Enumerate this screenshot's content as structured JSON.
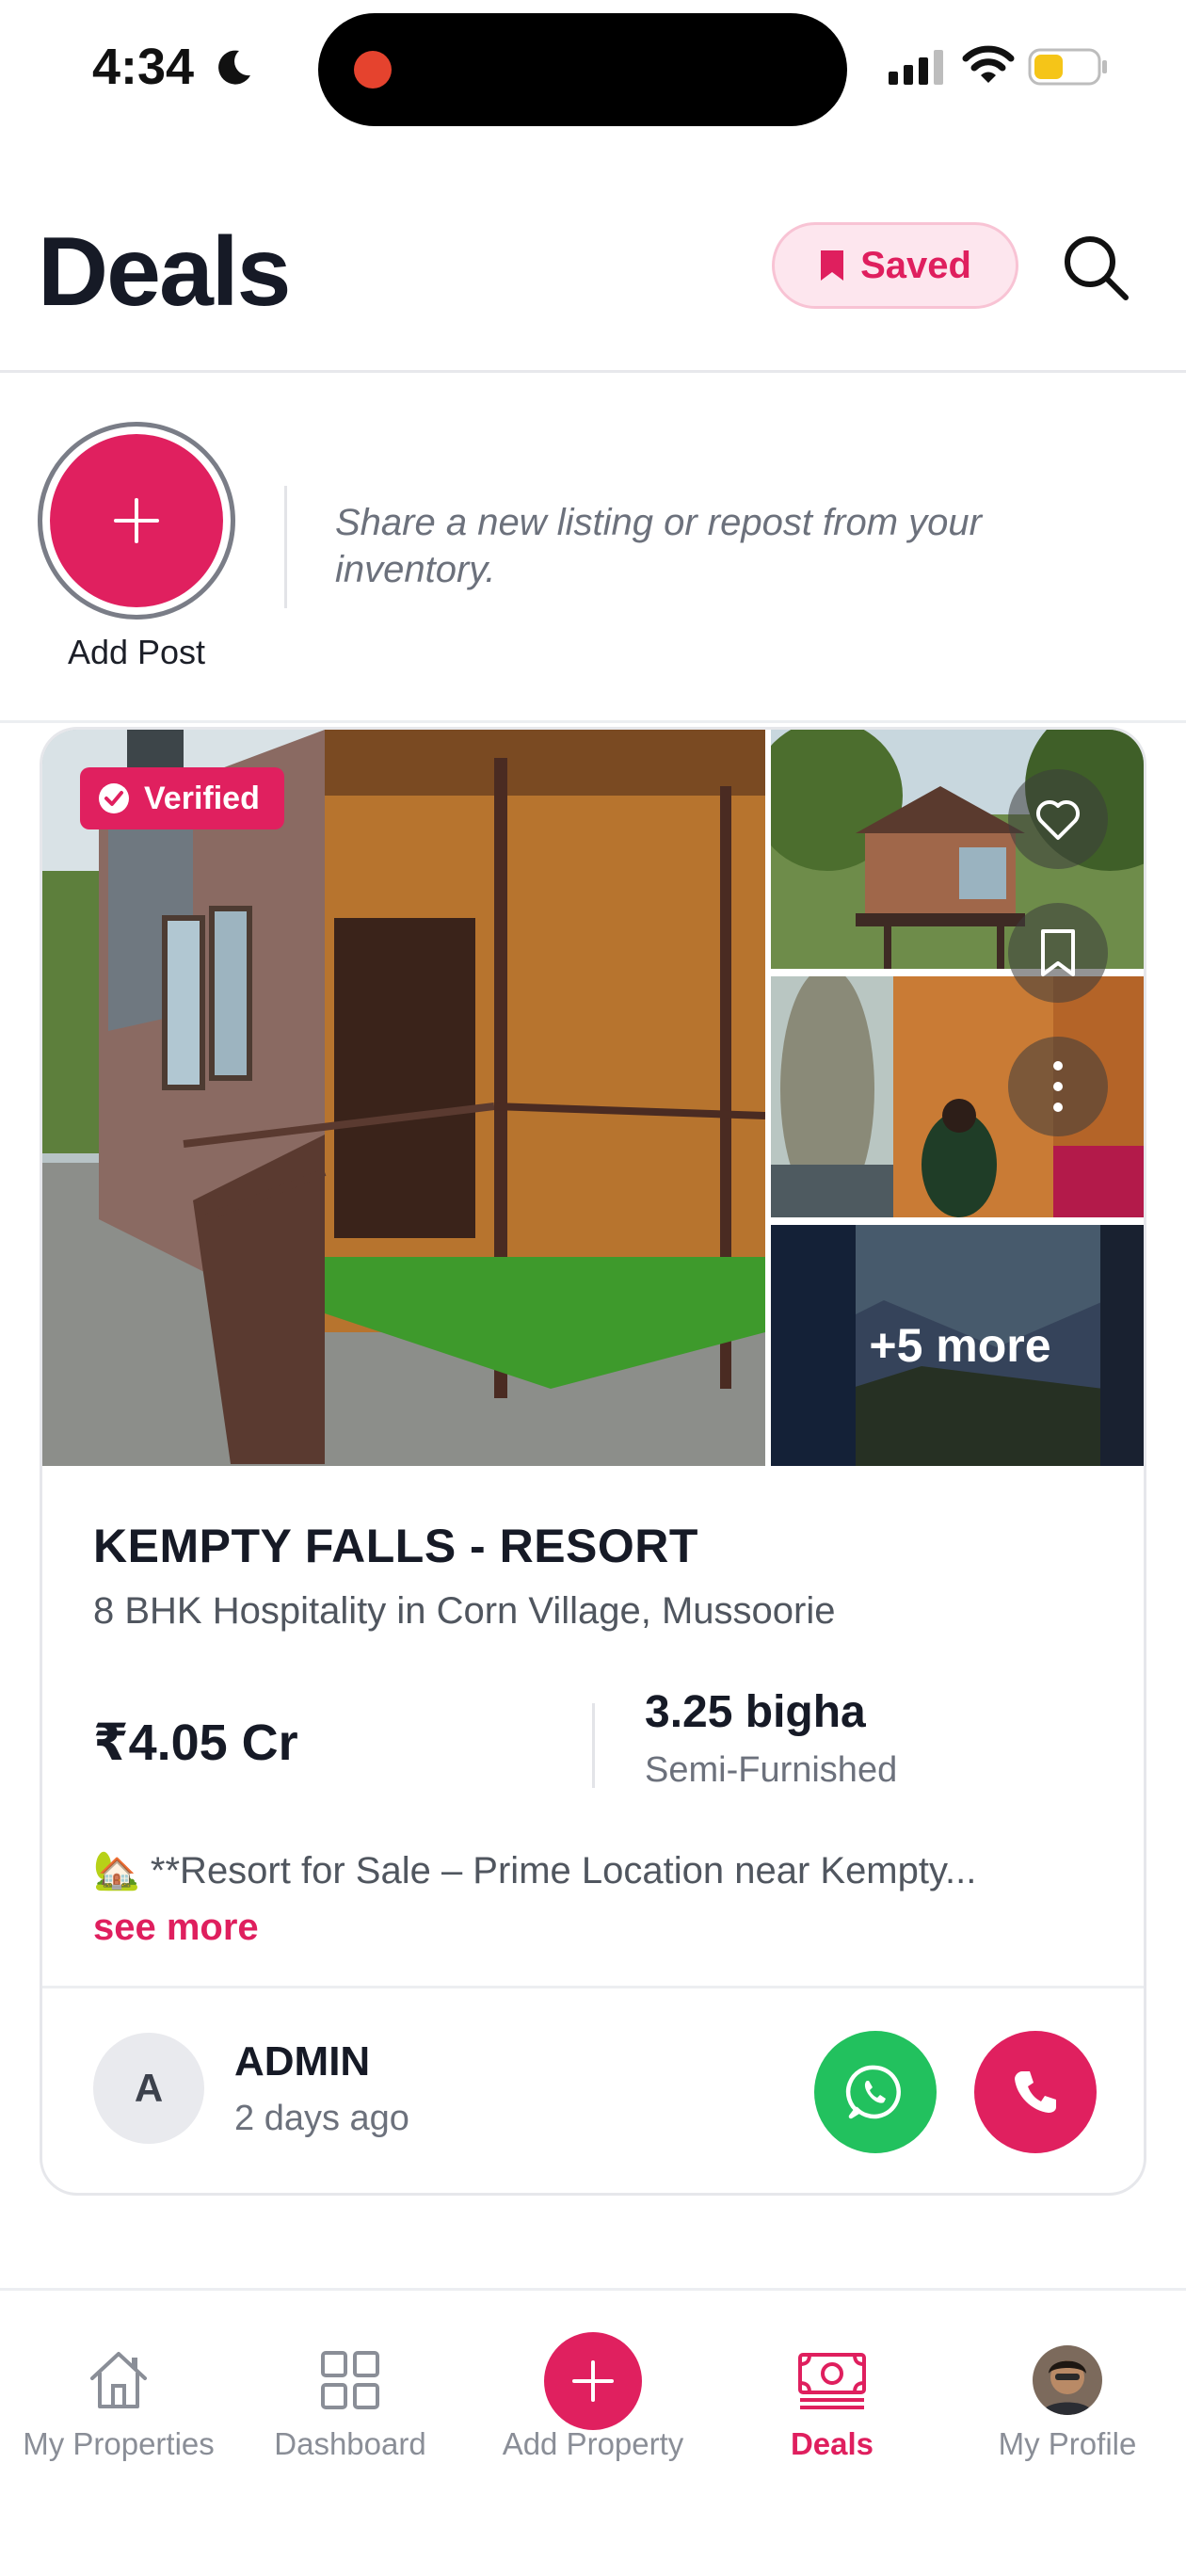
{
  "status_bar": {
    "time": "4:34"
  },
  "header": {
    "title": "Deals",
    "saved_label": "Saved"
  },
  "composer": {
    "add_post_label": "Add Post",
    "hint": "Share a new listing or repost from your inventory."
  },
  "listing": {
    "verified_label": "Verified",
    "more_photos_label": "+5 more",
    "title": "KEMPTY FALLS - RESORT",
    "subtitle": "8 BHK Hospitality in Corn Village, Mussoorie",
    "price": "₹4.05 Cr",
    "area": "3.25 bigha",
    "furnishing": "Semi-Furnished",
    "description": "🏡 **Resort for Sale – Prime Location near Kempty...",
    "see_more_label": "see more",
    "poster": {
      "initial": "A",
      "name": "ADMIN",
      "time_ago": "2 days ago"
    }
  },
  "bottom_nav": {
    "items": [
      {
        "label": "My Properties",
        "icon": "home-icon"
      },
      {
        "label": "Dashboard",
        "icon": "grid-icon"
      },
      {
        "label": "Add Property",
        "icon": "plus-icon"
      },
      {
        "label": "Deals",
        "icon": "cash-icon",
        "active": true
      },
      {
        "label": "My Profile",
        "icon": "avatar"
      }
    ]
  },
  "colors": {
    "accent": "#E0205F",
    "whatsapp": "#22C15E",
    "text_primary": "#161A26",
    "text_secondary": "#6C717C"
  }
}
